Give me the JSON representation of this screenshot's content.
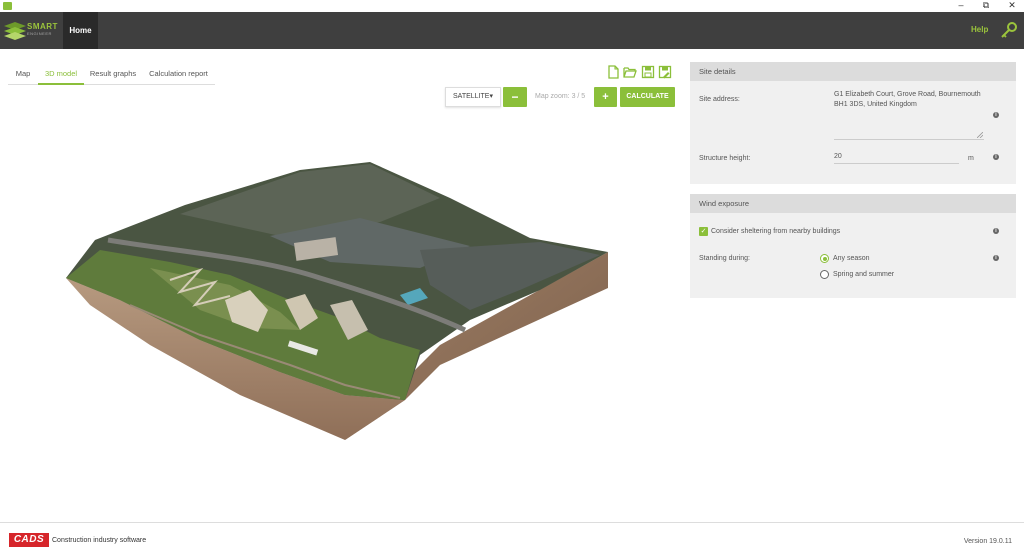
{
  "window": {
    "minimize": "–",
    "restore": "⧉",
    "close": "✕"
  },
  "header": {
    "logo_text_1": "SMART",
    "logo_text_2": "ENGINEER",
    "home_tab": "Home",
    "help": "Help"
  },
  "tabs": [
    {
      "label": "Map"
    },
    {
      "label": "3D model"
    },
    {
      "label": "Result graphs"
    },
    {
      "label": "Calculation report"
    }
  ],
  "toolbar": {
    "map_type": "SATELLITE▾",
    "zoom_out": "−",
    "zoom_label": "Map zoom: 3 / 5",
    "zoom_in": "+",
    "calculate": "CALCULATE"
  },
  "site_details": {
    "title": "Site details",
    "address_label": "Site address:",
    "address_line1": "G1 Elizabeth Court, Grove Road, Bournemouth",
    "address_line2": "BH1 3DS, United Kingdom",
    "height_label": "Structure height:",
    "height_value": "20",
    "height_unit": "m"
  },
  "wind_exposure": {
    "title": "Wind exposure",
    "sheltering_label": "Consider sheltering from nearby buildings",
    "sheltering_checked": true,
    "standing_label": "Standing during:",
    "options": [
      {
        "label": "Any season",
        "selected": true
      },
      {
        "label": "Spring and summer",
        "selected": false
      }
    ]
  },
  "footer": {
    "brand": "CADS",
    "tagline": "Construction industry software",
    "version": "Version 19.0.11"
  },
  "colors": {
    "accent": "#8bbf3a",
    "header": "#3f3f3f",
    "brand_red": "#d6252a"
  }
}
